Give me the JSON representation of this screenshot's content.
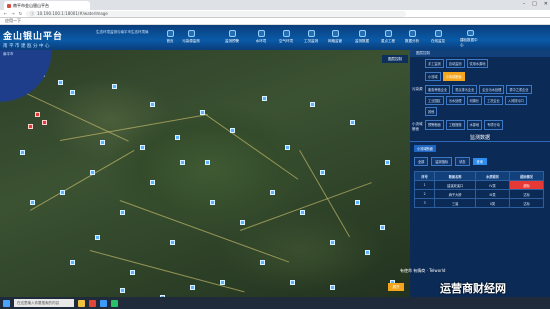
{
  "browser": {
    "tab_title": "南平市金山银山平台",
    "url": "10.190.100.1:18001/#/waterImage",
    "bookmark": "应用一下"
  },
  "header": {
    "title": "金山银山平台",
    "org": "南平市建瓯分中心",
    "subtitle": "生态环境监测与南平市生态环境局"
  },
  "nav": [
    {
      "label": "首页"
    },
    {
      "label": "污染源监测"
    },
    {
      "label": "监测预警"
    },
    {
      "label": "水环境"
    },
    {
      "label": "空气环境"
    },
    {
      "label": "工况监测"
    },
    {
      "label": "网格监管"
    },
    {
      "label": "监测数据"
    },
    {
      "label": "重点工程"
    },
    {
      "label": "数据分析"
    },
    {
      "label": "在线监控"
    },
    {
      "label": "建瓯数据中心"
    }
  ],
  "map": {
    "label": "南平市",
    "tip": "图层控制",
    "bottom_btn": "展开"
  },
  "panel": {
    "header": "图层控制",
    "groups": [
      {
        "label": "",
        "chips": [
          "手工监测",
          "自动监测",
          "饮用水源地"
        ]
      },
      {
        "label": "",
        "chips": [
          "小流域",
          "小流域断面"
        ],
        "active": 1
      },
      {
        "label": "污染源",
        "chips": [
          "畜禽养殖企业",
          "重点排污企业",
          "企业污水处理",
          "重中之重企业",
          "工业园区",
          "污水处理",
          "河湖长",
          "工况企业",
          "入河排污口",
          "其他"
        ]
      },
      {
        "label": "小流域断面",
        "chips": [
          "预警断面",
          "工程措施",
          "水源地",
          "专项行动"
        ]
      }
    ],
    "data_title": "监测数据",
    "data_tab": "小流域断面",
    "filter1": "全部",
    "filter2": "监测指标",
    "filter3": "状态",
    "query": "查询",
    "columns": [
      "序号",
      "断面名称",
      "水质现状",
      "超标情况"
    ],
    "rows": [
      [
        "1",
        "建溪双溪口",
        "IV类",
        "超标"
      ],
      [
        "2",
        "麻子大桥",
        "III类",
        "达标"
      ],
      [
        "3",
        "三溪",
        "II类",
        "达标"
      ]
    ]
  },
  "taskbar": {
    "search": "在这里输入你要搜索的内容"
  },
  "watermark": {
    "line1": "有使命 有情商 · Telworld",
    "line2": "运营商财经网",
    "line3": "有洞察 有态度"
  },
  "colors": {
    "accent": "#f3a51d",
    "alarm": "#e53935",
    "header_blue": "#0a5aa8"
  }
}
